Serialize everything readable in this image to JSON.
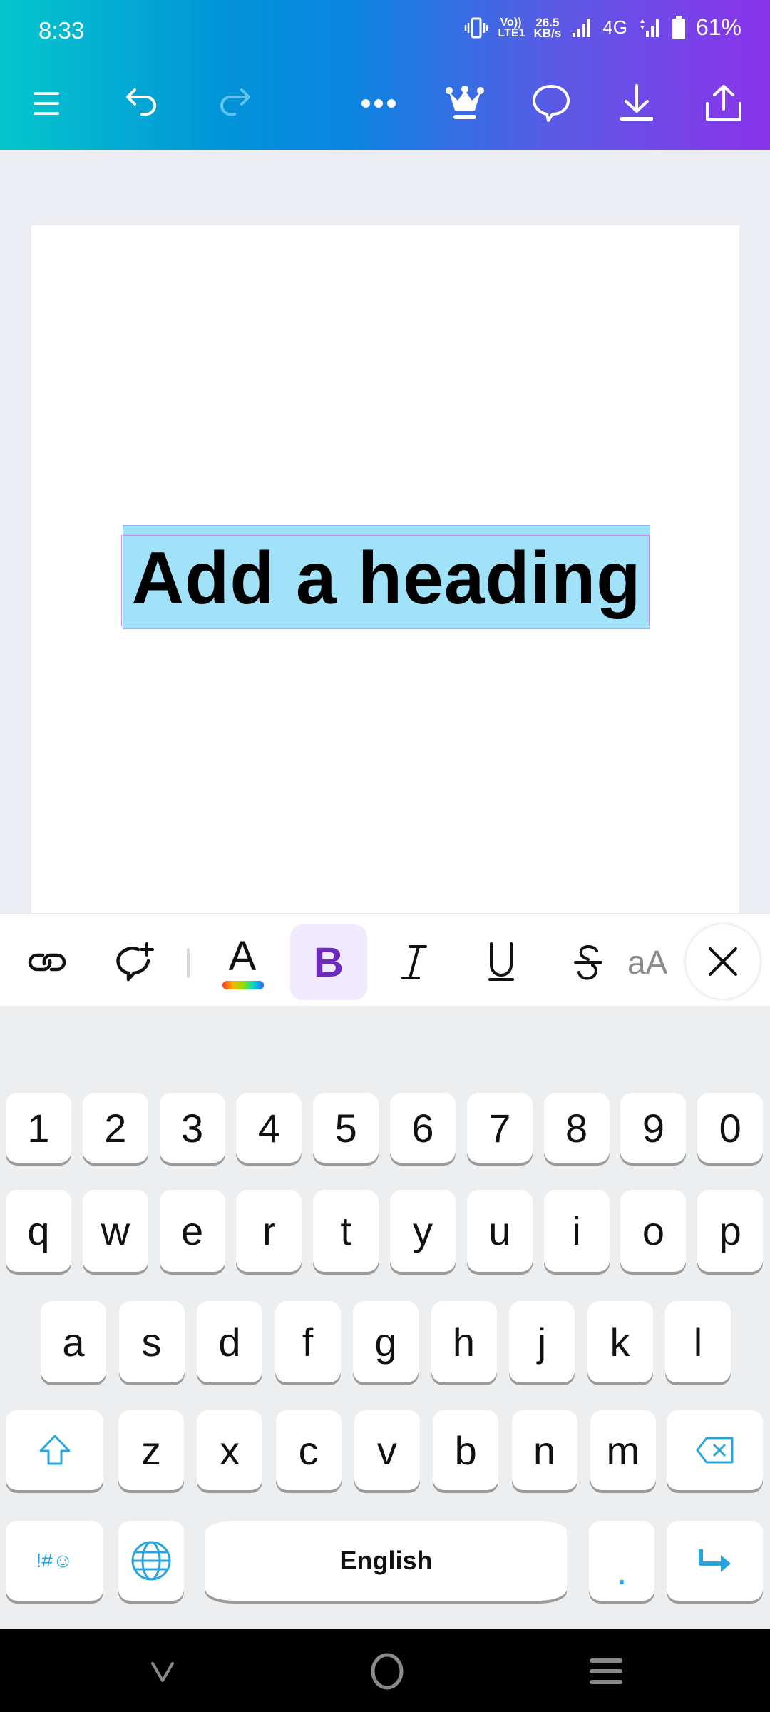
{
  "status_bar": {
    "time": "8:33",
    "volte": "Vo)) LTE1",
    "speed_value": "26.5",
    "speed_unit": "KB/s",
    "network": "4G",
    "battery": "61%"
  },
  "toolbar": {
    "icons": [
      "menu-icon",
      "undo-icon",
      "redo-icon",
      "more-icon",
      "crown-icon",
      "comment-icon",
      "download-icon",
      "share-icon"
    ]
  },
  "canvas": {
    "heading": "Add a heading"
  },
  "format_bar": {
    "bold_label": "B",
    "text_color_label": "A",
    "case_label": "aA",
    "items": [
      "link",
      "add-comment",
      "text-color",
      "bold",
      "italic",
      "underline",
      "strikethrough",
      "case",
      "close"
    ],
    "accent": "#6c2bbd",
    "active_bg": "#f1e9fd"
  },
  "keyboard": {
    "row_numbers": [
      "1",
      "2",
      "3",
      "4",
      "5",
      "6",
      "7",
      "8",
      "9",
      "0"
    ],
    "row_1": [
      "q",
      "w",
      "e",
      "r",
      "t",
      "y",
      "u",
      "i",
      "o",
      "p"
    ],
    "row_2": [
      "a",
      "s",
      "d",
      "f",
      "g",
      "h",
      "j",
      "k",
      "l"
    ],
    "row_3": [
      "z",
      "x",
      "c",
      "v",
      "b",
      "n",
      "m"
    ],
    "symbols_label": "!#☺",
    "space_label": "English",
    "period_label": ".",
    "accent": "#29a6e0"
  }
}
